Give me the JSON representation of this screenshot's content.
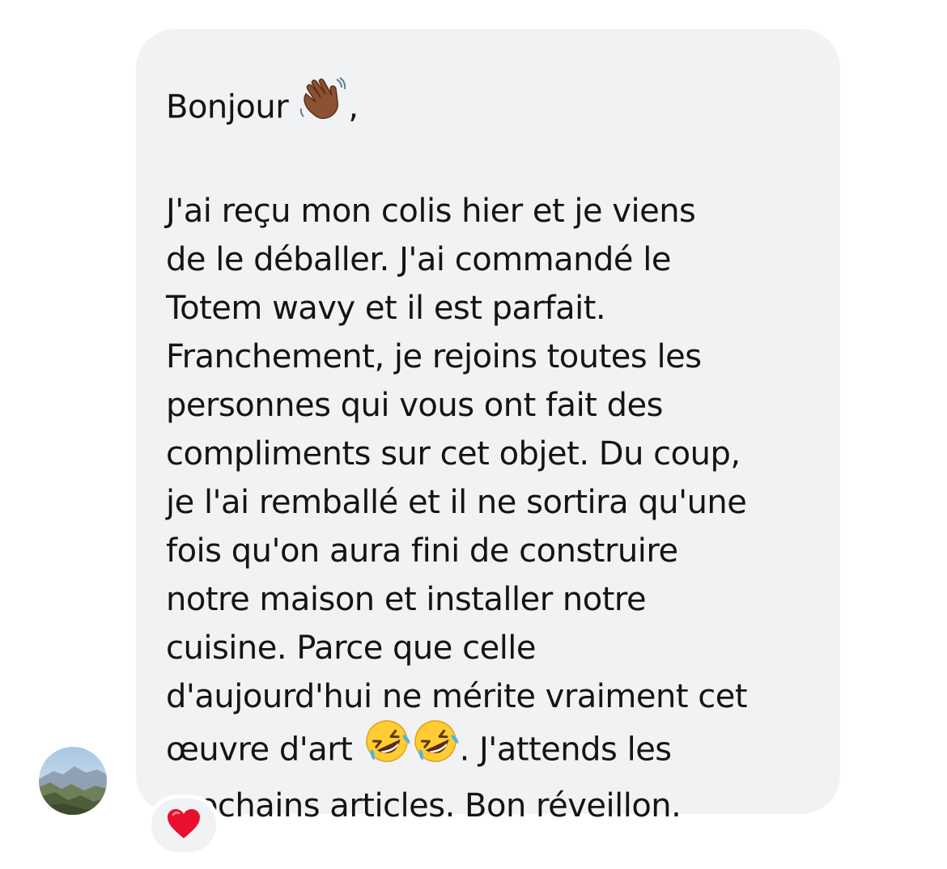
{
  "message": {
    "lines": [
      {
        "text": "Bonjour ",
        "trail": ","
      },
      {
        "text": ""
      },
      {
        "text": "J'ai reçu mon colis hier et je viens"
      },
      {
        "text": "de le déballer. J'ai commandé le"
      },
      {
        "text": "Totem wavy et il est parfait."
      },
      {
        "text": "Franchement, je rejoins toutes les"
      },
      {
        "text": "personnes qui vous ont fait des"
      },
      {
        "text": "compliments sur cet objet. Du coup,"
      },
      {
        "text": "je l'ai remballé et il ne sortira qu'une"
      },
      {
        "text": "fois qu'on aura fini de construire"
      },
      {
        "text": "notre maison et installer notre"
      },
      {
        "text": "cuisine. Parce que celle"
      },
      {
        "text": "d'aujourd'hui ne mérite vraiment cet"
      },
      {
        "text": "œuvre d'art ",
        "trail": ". J'attends les"
      },
      {
        "text": "prochains articles. Bon réveillon."
      }
    ],
    "greeting_emoji": "waving-hand-icon",
    "laugh_emoji": "rolling-on-floor-laughing-icon"
  },
  "avatar": {
    "icon": "landscape-avatar"
  },
  "reaction": {
    "icon": "red-heart-icon",
    "color": "#e8102e"
  },
  "colors": {
    "bubble": "#f1f2f4",
    "text": "#141414"
  }
}
